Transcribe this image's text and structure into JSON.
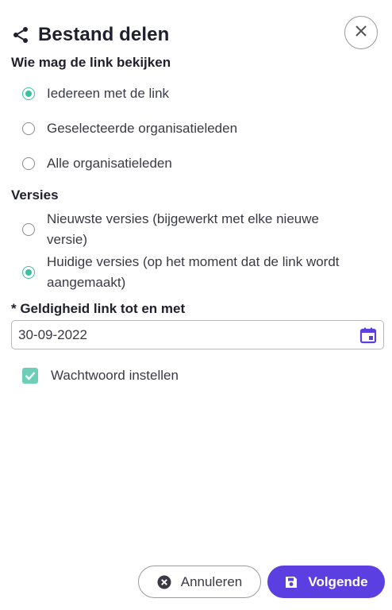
{
  "dialog": {
    "title": "Bestand delen",
    "share_icon": "share-icon",
    "close_icon": "close-icon"
  },
  "visibility": {
    "label": "Wie mag de link bekijken",
    "options": [
      {
        "label": "Iedereen met de link",
        "checked": true
      },
      {
        "label": "Geselecteerde organisatieleden",
        "checked": false
      },
      {
        "label": "Alle organisatieleden",
        "checked": false
      }
    ]
  },
  "versions": {
    "label": "Versies",
    "options": [
      {
        "label": "Nieuwste versies (bijgewerkt met elke nieuwe versie)",
        "checked": false
      },
      {
        "label": "Huidige versies (op het moment dat de link wordt aangemaakt)",
        "checked": true
      }
    ]
  },
  "validity": {
    "label": "* Geldigheid link tot en met",
    "value": "30-09-2022",
    "icon": "calendar-icon"
  },
  "password": {
    "label": "Wachtwoord instellen",
    "checked": true
  },
  "footer": {
    "cancel_label": "Annuleren",
    "next_label": "Volgende",
    "cancel_icon": "cancel-icon",
    "save_icon": "save-icon"
  },
  "colors": {
    "accent": "#3dbfa2",
    "primary_button": "#5b3fe0"
  }
}
